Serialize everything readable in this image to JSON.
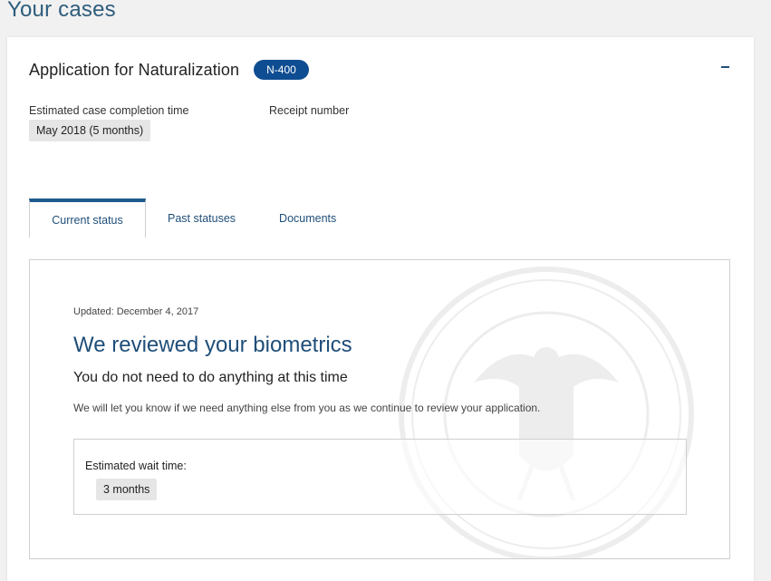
{
  "page": {
    "title": "Your cases"
  },
  "case": {
    "title": "Application for Naturalization",
    "form_badge": "N-400",
    "collapse_symbol": "−",
    "estimated_completion_label": "Estimated case completion time",
    "estimated_completion_value": "May 2018 (5 months)",
    "receipt_number_label": "Receipt number"
  },
  "tabs": [
    {
      "label": "Current status",
      "active": true
    },
    {
      "label": "Past statuses",
      "active": false
    },
    {
      "label": "Documents",
      "active": false
    }
  ],
  "status": {
    "updated": "Updated: December 4, 2017",
    "title": "We reviewed your biometrics",
    "subtitle": "You do not need to do anything at this time",
    "description": "We will let you know if we need anything else from you as we continue to review your application.",
    "wait_label": "Estimated wait time:",
    "wait_value": "3 months"
  },
  "colors": {
    "accent": "#1f4e79",
    "badge": "#0f4d92",
    "tab_active_border": "#1d5a8e"
  },
  "icons": {
    "seal": "dhs-seal-watermark",
    "collapse": "minus-icon"
  }
}
